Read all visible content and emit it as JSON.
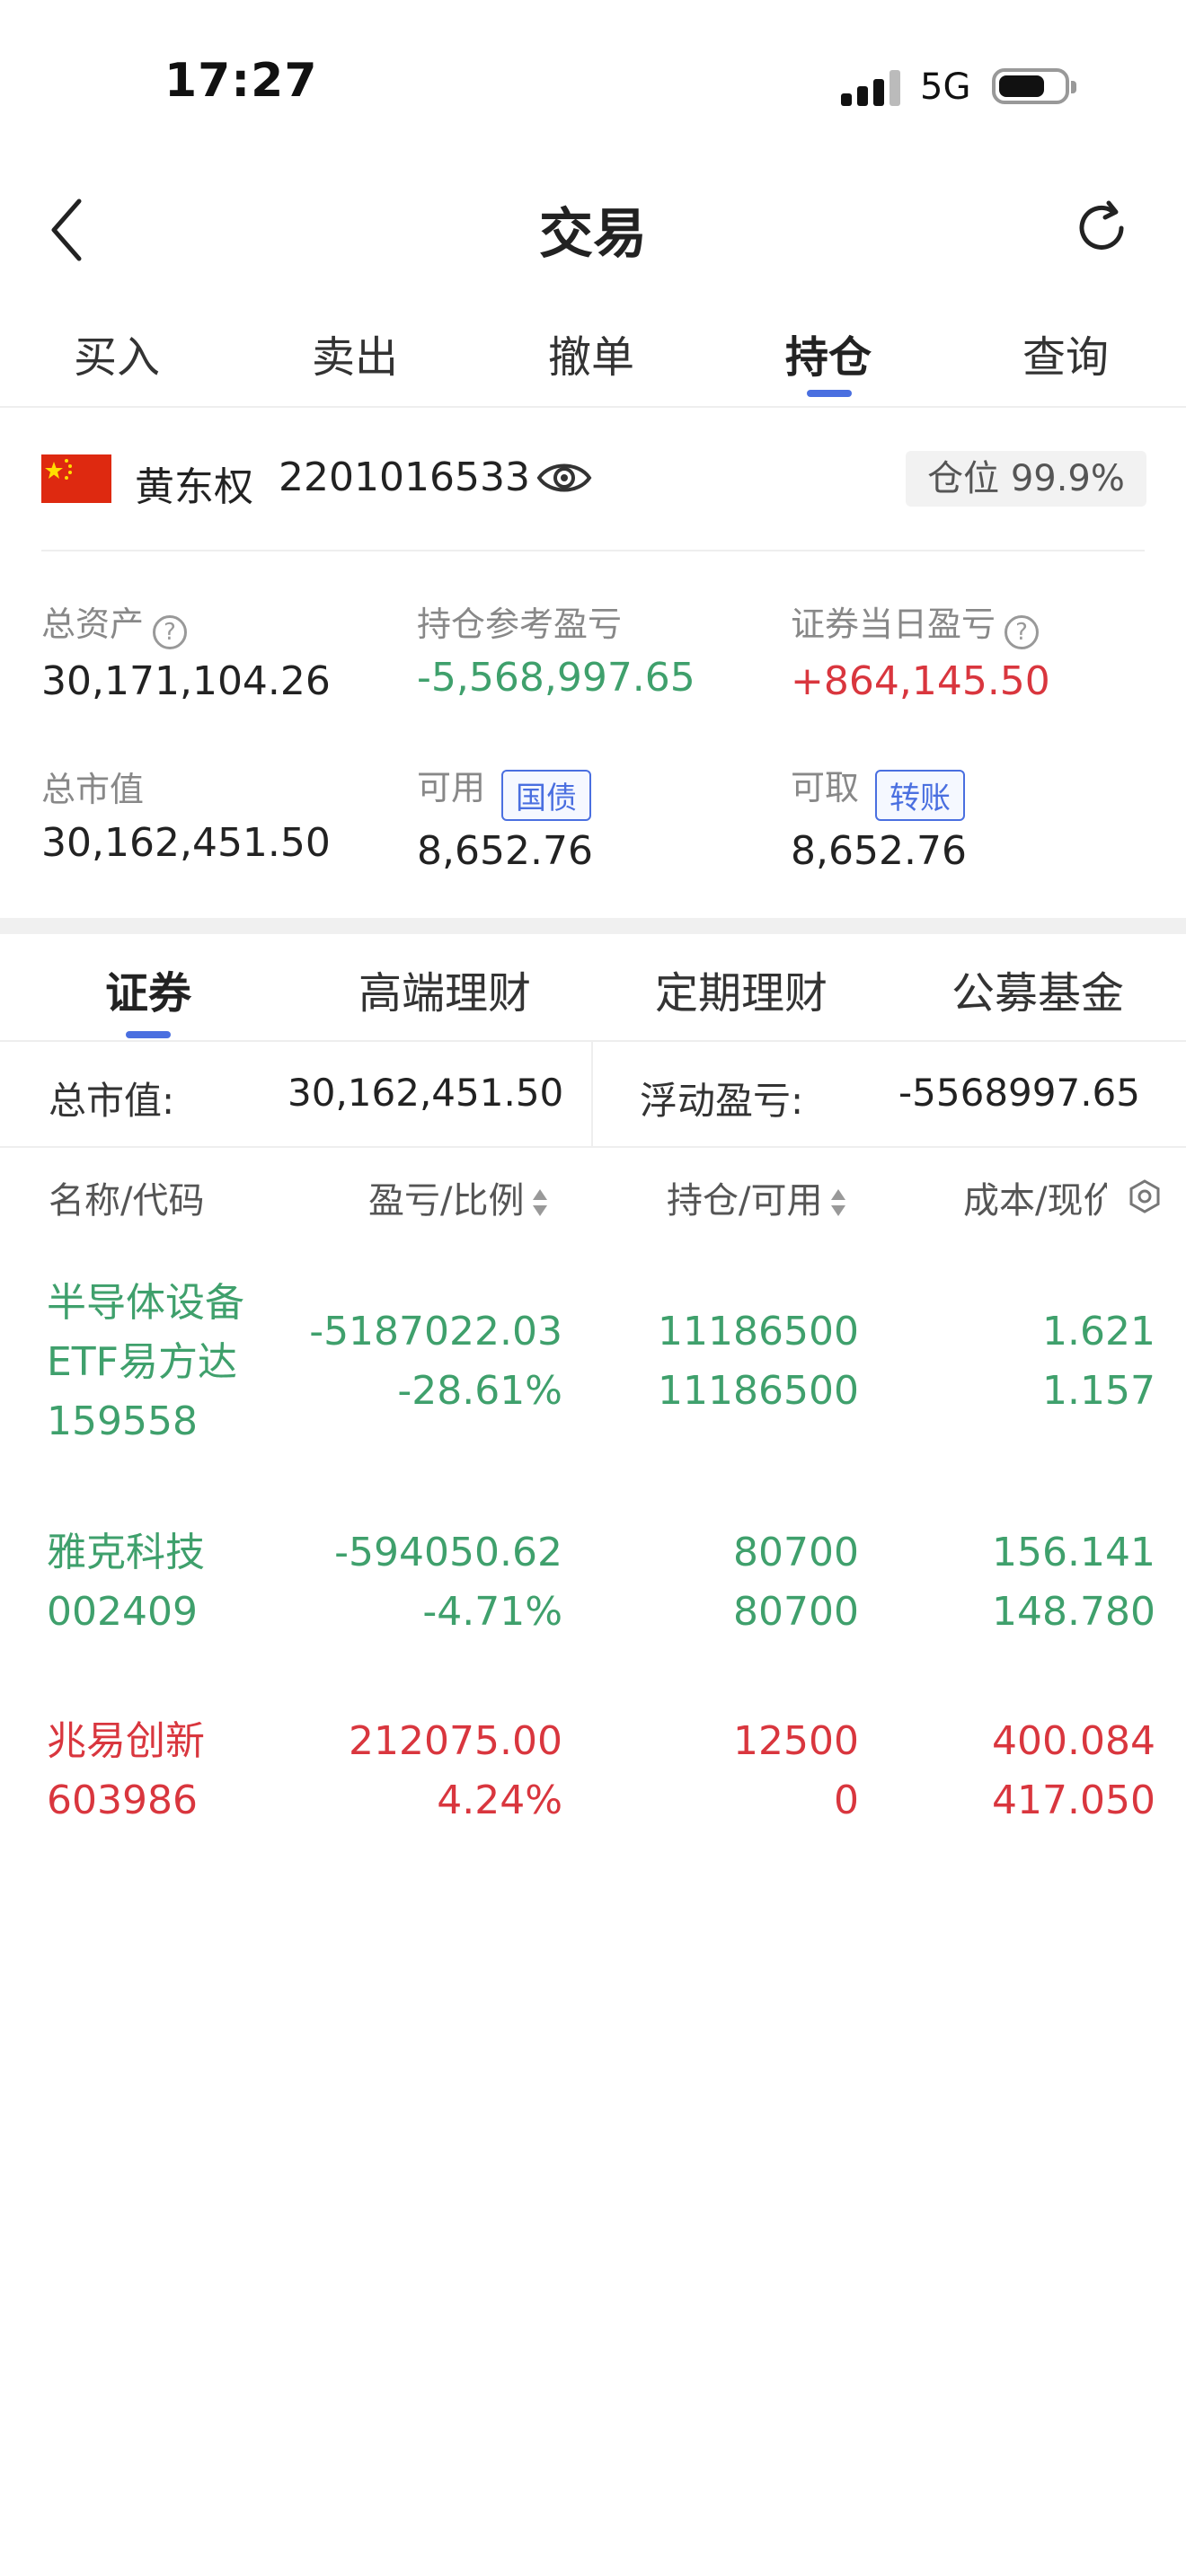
{
  "status": {
    "time": "17:27",
    "network": "5G"
  },
  "header": {
    "title": "交易",
    "back_icon": "chevron-left-icon",
    "refresh_icon": "refresh-icon"
  },
  "tabs": [
    {
      "label": "买入",
      "active": false
    },
    {
      "label": "卖出",
      "active": false
    },
    {
      "label": "撤单",
      "active": false
    },
    {
      "label": "持仓",
      "active": true
    },
    {
      "label": "查询",
      "active": false
    }
  ],
  "account": {
    "name": "黄东权",
    "id": "2201016533",
    "position_label": "仓位",
    "position_value": "99.9%"
  },
  "summary": {
    "total_assets_label": "总资产",
    "total_assets": "30,171,104.26",
    "hold_pl_label": "持仓参考盈亏",
    "hold_pl": "-5,568,997.65",
    "day_pl_label": "证券当日盈亏",
    "day_pl": "+864,145.50",
    "market_value_label": "总市值",
    "market_value": "30,162,451.50",
    "available_label": "可用",
    "available_tag": "国债",
    "available": "8,652.76",
    "withdrawable_label": "可取",
    "withdrawable_tag": "转账",
    "withdrawable": "8,652.76"
  },
  "subtabs": [
    {
      "label": "证券",
      "active": true
    },
    {
      "label": "高端理财",
      "active": false
    },
    {
      "label": "定期理财",
      "active": false
    },
    {
      "label": "公募基金",
      "active": false
    }
  ],
  "totals": {
    "market_value_label": "总市值:",
    "market_value": "30,162,451.50",
    "floating_pl_label": "浮动盈亏:",
    "floating_pl": "-5568997.65"
  },
  "columns": {
    "name": "名称/代码",
    "pl": "盈亏/比例",
    "hold": "持仓/可用",
    "cost": "成本/现价"
  },
  "holdings": [
    {
      "name1": "半导体设备",
      "name2": "ETF易方达",
      "code": "159558",
      "pl": "-5187022.03",
      "pl_pct": "-28.61%",
      "hold": "11186500",
      "avail": "11186500",
      "cost": "1.621",
      "price": "1.157",
      "color": "#3fa06c"
    },
    {
      "name1": "雅克科技",
      "code": "002409",
      "pl": "-594050.62",
      "pl_pct": "-4.71%",
      "hold": "80700",
      "avail": "80700",
      "cost": "156.141",
      "price": "148.780",
      "color": "#3fa06c"
    },
    {
      "name1": "兆易创新",
      "code": "603986",
      "pl": "212075.00",
      "pl_pct": "4.24%",
      "hold": "12500",
      "avail": "0",
      "cost": "400.084",
      "price": "417.050",
      "color": "#d9363e"
    }
  ]
}
